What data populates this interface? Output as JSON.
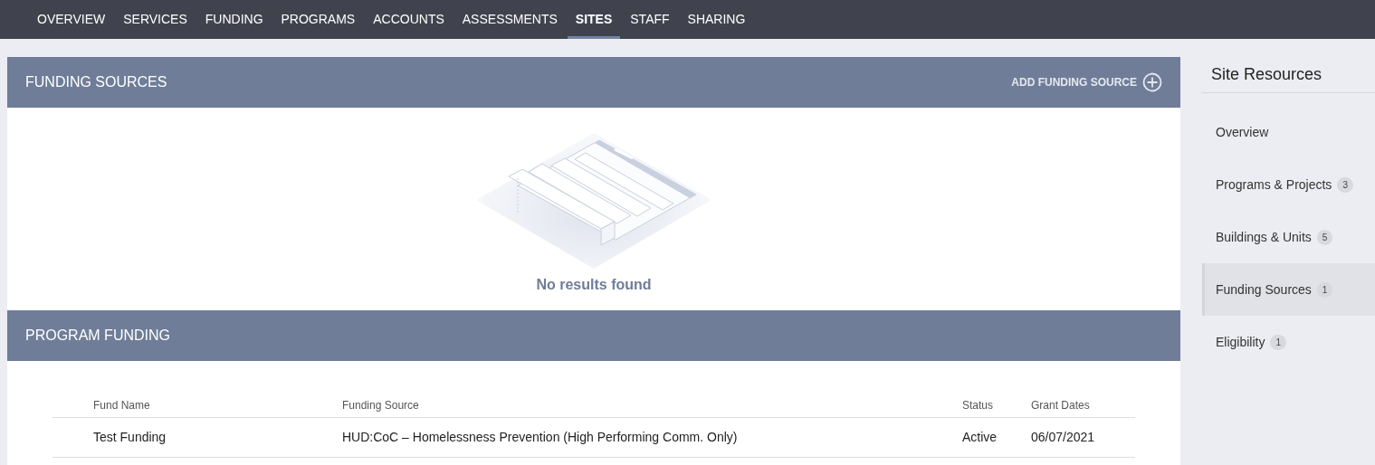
{
  "nav": [
    {
      "label": "OVERVIEW",
      "selected": false
    },
    {
      "label": "SERVICES",
      "selected": false
    },
    {
      "label": "FUNDING",
      "selected": false
    },
    {
      "label": "PROGRAMS",
      "selected": false
    },
    {
      "label": "ACCOUNTS",
      "selected": false
    },
    {
      "label": "ASSESSMENTS",
      "selected": false
    },
    {
      "label": "SITES",
      "selected": true
    },
    {
      "label": "STAFF",
      "selected": false
    },
    {
      "label": "SHARING",
      "selected": false
    }
  ],
  "funding_sources": {
    "title": "FUNDING SOURCES",
    "add_button": "ADD FUNDING SOURCE",
    "empty_message": "No results found"
  },
  "program_funding": {
    "title": "PROGRAM FUNDING",
    "columns": [
      "Fund Name",
      "Funding Source",
      "Status",
      "Grant Dates"
    ],
    "rows": [
      [
        "Test Funding",
        "HUD:CoC – Homelessness Prevention (High Performing Comm. Only)",
        "Active",
        "06/07/2021"
      ]
    ]
  },
  "sidebar": {
    "title": "Site Resources",
    "items": [
      {
        "label": "Overview",
        "selected": false
      },
      {
        "label": "Programs & Projects",
        "count": "3",
        "selected": false
      },
      {
        "label": "Buildings & Units",
        "count": "5",
        "selected": false
      },
      {
        "label": "Funding Sources",
        "count": "1",
        "selected": true
      },
      {
        "label": "Eligibility",
        "count": "1",
        "selected": false
      }
    ]
  }
}
